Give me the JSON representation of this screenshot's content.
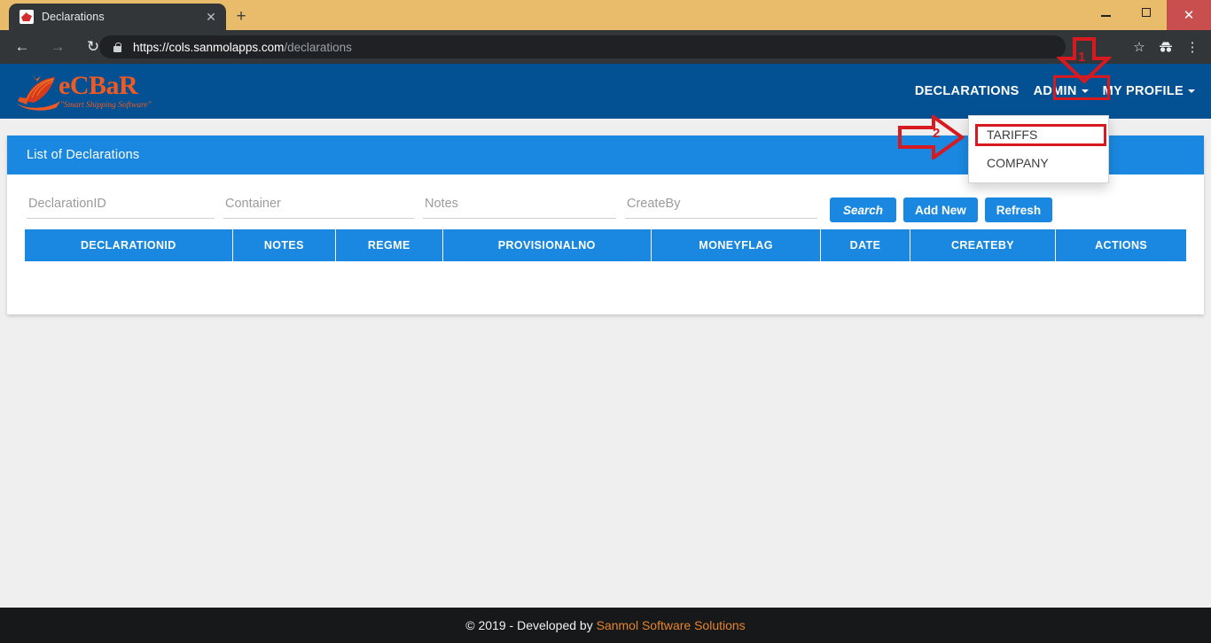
{
  "browser": {
    "tab": {
      "title": "Declarations",
      "favicon_icon": "ship-favicon",
      "close_icon": "close-icon"
    },
    "new_tab_icon": "plus-icon",
    "window_controls": {
      "minimize_icon": "minimize-icon",
      "maximize_icon": "maximize-icon",
      "close_icon": "close-icon"
    },
    "nav": {
      "back_icon": "arrow-left-icon",
      "forward_icon": "arrow-right-icon",
      "reload_icon": "reload-icon"
    },
    "address_bar": {
      "lock_icon": "lock-icon",
      "url_origin": "https://cols.sanmolapps.com",
      "url_path": "/declarations",
      "full_url": "https://cols.sanmolapps.com/declarations"
    },
    "toolbar_icons": [
      "star-icon",
      "incognito-icon",
      "kebab-menu-icon"
    ]
  },
  "app": {
    "logo": {
      "name": "DeCBaR",
      "text_main": "eCBaR",
      "tagline": "\"Smart Shipping Software\"",
      "icon": "ship-logo-icon"
    },
    "navbar": {
      "items": [
        {
          "label": "DECLARATIONS",
          "has_caret": false
        },
        {
          "label": "ADMIN",
          "has_caret": true
        },
        {
          "label": "MY PROFILE",
          "has_caret": true
        }
      ]
    },
    "dropdown": {
      "open_for": "ADMIN",
      "items": [
        {
          "label": "TARIFFS"
        },
        {
          "label": "COMPANY"
        }
      ]
    }
  },
  "card": {
    "title": "List of Declarations",
    "filters": [
      {
        "name": "declarationid",
        "placeholder": "DeclarationID",
        "value": ""
      },
      {
        "name": "container",
        "placeholder": "Container",
        "value": ""
      },
      {
        "name": "notes",
        "placeholder": "Notes",
        "value": ""
      },
      {
        "name": "createby",
        "placeholder": "CreateBy",
        "value": ""
      }
    ],
    "buttons": [
      {
        "name": "search",
        "label": "Search"
      },
      {
        "name": "add-new",
        "label": "Add New"
      },
      {
        "name": "refresh",
        "label": "Refresh"
      }
    ],
    "table": {
      "columns": [
        "DECLARATIONID",
        "NOTES",
        "REGME",
        "PROVISIONALNO",
        "MONEYFLAG",
        "DATE",
        "CREATEBY",
        "ACTIONS"
      ],
      "rows": []
    }
  },
  "footer": {
    "copyright": "© 2019 - Developed by ",
    "company": "Sanmol Software Solutions"
  },
  "annotations": [
    {
      "id": "1",
      "label": "1",
      "target": "ADMIN",
      "shape": "down-arrow"
    },
    {
      "id": "2",
      "label": "2",
      "target": "TARIFFS",
      "shape": "right-arrow"
    }
  ],
  "colors": {
    "navbar_blue": "#035192",
    "panel_blue": "#1a88e0",
    "logo_orange": "#f05a22",
    "annotation_red": "#d71920",
    "footer_bg": "#16181a",
    "footer_link": "#e8842c",
    "page_bg": "#efefef"
  }
}
